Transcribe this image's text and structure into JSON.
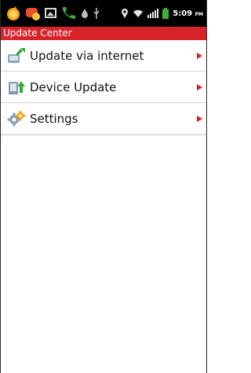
{
  "status_bar": {
    "time": "5:09",
    "ampm": "PM",
    "left_icons": [
      "notification-app-icon",
      "notification-chat-icon",
      "notification-image-icon",
      "notification-phone-icon",
      "notification-drop-icon",
      "usb-icon"
    ],
    "right_icons": [
      "location-pin-icon",
      "wifi-icon",
      "signal-icon",
      "battery-icon"
    ]
  },
  "title_bar": {
    "title": "Update Center",
    "color": "#d8232a"
  },
  "menu": {
    "items": [
      {
        "label": "Update via internet",
        "icon": "internet-update-icon"
      },
      {
        "label": "Device Update",
        "icon": "device-update-icon"
      },
      {
        "label": "Settings",
        "icon": "gear-icon"
      }
    ]
  },
  "colors": {
    "accent": "#d8232a",
    "arrow": "#e11b1b",
    "divider": "#d4d4d4"
  }
}
